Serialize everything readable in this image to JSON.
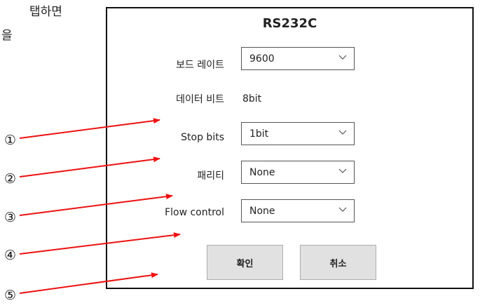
{
  "cut_text": [
    "탭하면",
    "을"
  ],
  "dialog": {
    "title": "RS232C",
    "rows": [
      {
        "label": "보드 레이트",
        "value": "9600",
        "kind": "select"
      },
      {
        "label": "데이터 비트",
        "value": "8bit",
        "kind": "static"
      },
      {
        "label": "Stop bits",
        "value": "1bit",
        "kind": "select"
      },
      {
        "label": "패리티",
        "value": "None",
        "kind": "select"
      },
      {
        "label": "Flow control",
        "value": "None",
        "kind": "select"
      }
    ],
    "ok_label": "확인",
    "cancel_label": "취소"
  },
  "markers": [
    "①",
    "②",
    "③",
    "④",
    "⑤"
  ],
  "colors": {
    "arrow": "#ee1111",
    "border": "#111111",
    "button": "#e1e1e1"
  }
}
